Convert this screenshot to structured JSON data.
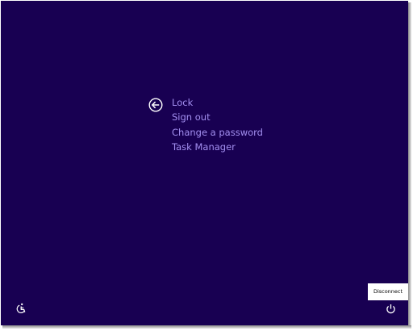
{
  "menu": {
    "items": [
      {
        "label": "Lock"
      },
      {
        "label": "Sign out"
      },
      {
        "label": "Change a password"
      },
      {
        "label": "Task Manager"
      }
    ]
  },
  "icons": {
    "back": "back-arrow-circle-icon",
    "ease_of_access": "ease-of-access-icon",
    "power": "power-icon"
  },
  "tooltip": {
    "text": "Disconnect"
  },
  "colors": {
    "background": "#180052",
    "menu_text": "#a38ff0",
    "icon": "#ffffff",
    "tooltip_bg": "#ffffff",
    "tooltip_text": "#000000"
  }
}
